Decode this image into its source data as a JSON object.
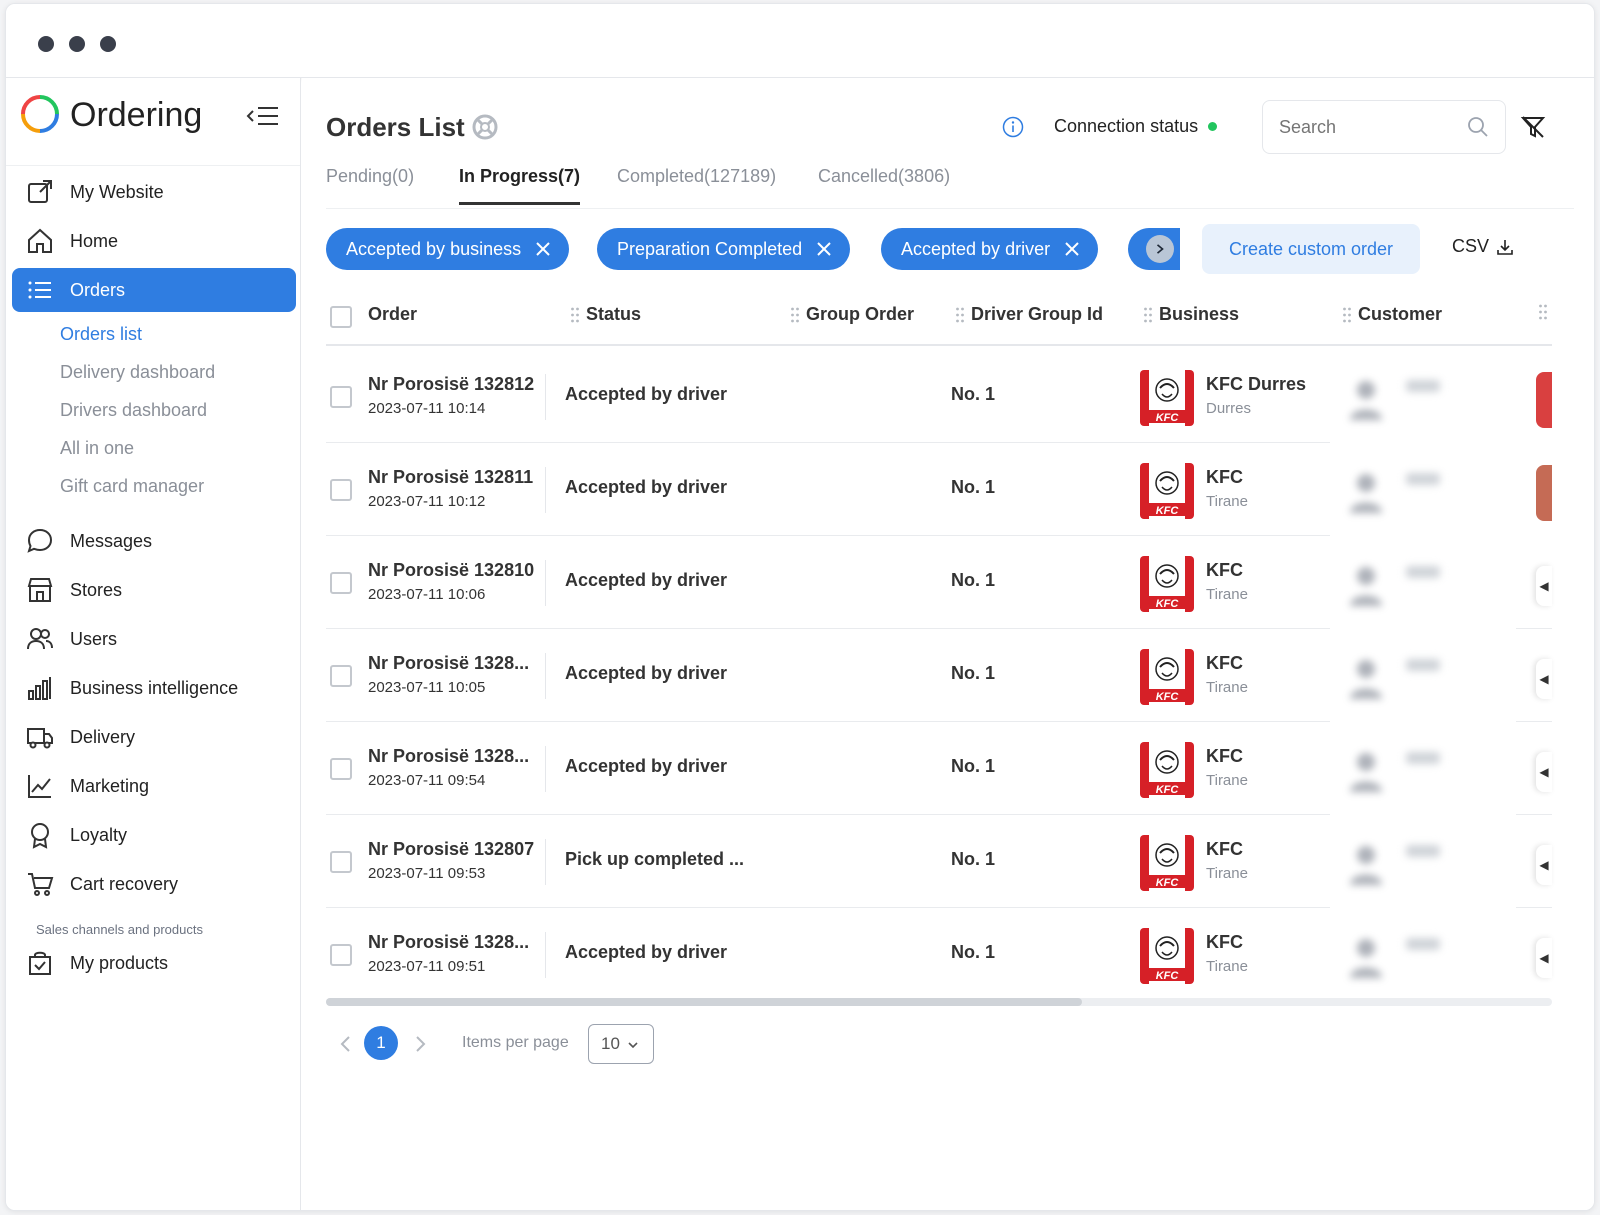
{
  "brand": {
    "name": "Ordering"
  },
  "sidebar": {
    "items": [
      {
        "label": "My Website",
        "icon": "external-link-icon"
      },
      {
        "label": "Home",
        "icon": "home-icon"
      },
      {
        "label": "Orders",
        "icon": "list-icon",
        "active": true
      },
      {
        "label": "Messages",
        "icon": "chat-icon"
      },
      {
        "label": "Stores",
        "icon": "store-icon"
      },
      {
        "label": "Users",
        "icon": "users-icon"
      },
      {
        "label": "Business intelligence",
        "icon": "bar-chart-icon"
      },
      {
        "label": "Delivery",
        "icon": "truck-icon"
      },
      {
        "label": "Marketing",
        "icon": "line-chart-icon"
      },
      {
        "label": "Loyalty",
        "icon": "award-icon"
      },
      {
        "label": "Cart recovery",
        "icon": "cart-icon"
      },
      {
        "label": "My products",
        "icon": "bag-check-icon"
      }
    ],
    "sub_items": [
      {
        "label": "Orders list",
        "active": true
      },
      {
        "label": "Delivery dashboard"
      },
      {
        "label": "Drivers dashboard"
      },
      {
        "label": "All in one"
      },
      {
        "label": "Gift card manager"
      }
    ],
    "section_label": "Sales channels and products"
  },
  "header": {
    "title": "Orders List",
    "connection_label": "Connection status",
    "connection_color": "#22c55e",
    "search_placeholder": "Search"
  },
  "tabs": [
    {
      "label": "Pending(0)"
    },
    {
      "label": "In Progress(7)",
      "active": true
    },
    {
      "label": "Completed(127189)"
    },
    {
      "label": "Cancelled(3806)"
    }
  ],
  "filters": {
    "chips": [
      "Accepted by business",
      "Preparation Completed",
      "Accepted by driver"
    ],
    "custom_order_label": "Create custom order",
    "csv_label": "CSV"
  },
  "table": {
    "columns": [
      "Order",
      "Status",
      "Group Order",
      "Driver Group Id",
      "Business",
      "Customer"
    ],
    "rows": [
      {
        "order": "Nr Porosisë 132812",
        "date": "2023-07-11 10:14",
        "status": "Accepted by driver",
        "driver_group": "No. 1",
        "business": "KFC Durres",
        "city": "Durres"
      },
      {
        "order": "Nr Porosisë 132811",
        "date": "2023-07-11 10:12",
        "status": "Accepted by driver",
        "driver_group": "No. 1",
        "business": "KFC",
        "city": "Tirane"
      },
      {
        "order": "Nr Porosisë 132810",
        "date": "2023-07-11 10:06",
        "status": "Accepted by driver",
        "driver_group": "No. 1",
        "business": "KFC",
        "city": "Tirane"
      },
      {
        "order": "Nr Porosisë 1328...",
        "date": "2023-07-11 10:05",
        "status": "Accepted by driver",
        "driver_group": "No. 1",
        "business": "KFC",
        "city": "Tirane"
      },
      {
        "order": "Nr Porosisë 1328...",
        "date": "2023-07-11 09:54",
        "status": "Accepted by driver",
        "driver_group": "No. 1",
        "business": "KFC",
        "city": "Tirane"
      },
      {
        "order": "Nr Porosisë 132807",
        "date": "2023-07-11 09:53",
        "status": "Pick up completed ...",
        "driver_group": "No. 1",
        "business": "KFC",
        "city": "Tirane"
      },
      {
        "order": "Nr Porosisë 1328...",
        "date": "2023-07-11 09:51",
        "status": "Accepted by driver",
        "driver_group": "No. 1",
        "business": "KFC",
        "city": "Tirane"
      }
    ]
  },
  "pagination": {
    "current_page": "1",
    "items_per_page_label": "Items per page",
    "items_per_page_value": "10"
  },
  "colors": {
    "accent": "#2f7de1",
    "accent_light": "#e8f1fc",
    "kfc_red": "#d62027"
  }
}
